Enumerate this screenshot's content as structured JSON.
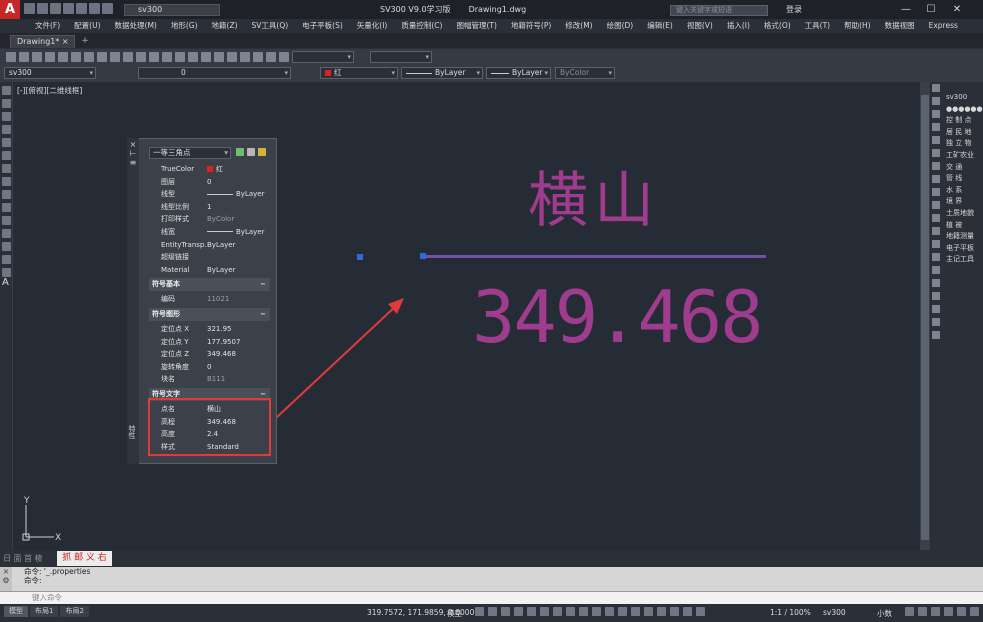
{
  "app": {
    "title": "SV300 V9.0学习版",
    "file": "Drawing1.dwg",
    "workspace": "sv300",
    "search_placeholder": "键入关键字或短语",
    "login": "登录"
  },
  "menu": [
    "文件(F)",
    "配置(U)",
    "数据处理(M)",
    "地形(G)",
    "地籍(Z)",
    "SV工具(Q)",
    "电子平板(S)",
    "矢量化(I)",
    "质量控制(C)",
    "图幅管理(T)",
    "地籍符号(P)",
    "修改(M)",
    "绘图(D)",
    "编辑(E)",
    "视图(V)",
    "插入(I)",
    "格式(O)",
    "工具(T)",
    "帮助(H)",
    "数据视图",
    "Express"
  ],
  "doc_tab": "Drawing1*",
  "toolbar": {
    "layer_combo": "sv300",
    "layer_state": "0",
    "color": "红",
    "linetype": "ByLayer",
    "lineweight": "ByLayer",
    "plotstyle": "ByColor"
  },
  "viewport_label": "[-][俯视][二维线框]",
  "drawing": {
    "name_text": "横山",
    "elev_text": "349.468",
    "text_color": "#a03c8e",
    "line_color": "#7050a8"
  },
  "properties": {
    "object_type": "一等三角点",
    "general": [
      {
        "k": "TrueColor",
        "v": "红",
        "swatch": true
      },
      {
        "k": "图层",
        "v": "0"
      },
      {
        "k": "线型",
        "v": "ByLayer",
        "line": true
      },
      {
        "k": "线型比例",
        "v": "1"
      },
      {
        "k": "打印样式",
        "v": "ByColor",
        "dim": true
      },
      {
        "k": "线宽",
        "v": "ByLayer",
        "line": true
      },
      {
        "k": "EntityTransp...",
        "v": "ByLayer"
      },
      {
        "k": "超级链接",
        "v": ""
      },
      {
        "k": "Material",
        "v": "ByLayer"
      }
    ],
    "sec_basic": "符号基本",
    "basic": [
      {
        "k": "编码",
        "v": "11021",
        "dim": true
      }
    ],
    "sec_shape": "符号图形",
    "shape": [
      {
        "k": "定位点 X",
        "v": "321.95"
      },
      {
        "k": "定位点 Y",
        "v": "177.9507"
      },
      {
        "k": "定位点 Z",
        "v": "349.468"
      },
      {
        "k": "旋转角度",
        "v": "0"
      },
      {
        "k": "块名",
        "v": "B111",
        "dim": true
      }
    ],
    "sec_text": "符号文字",
    "text": [
      {
        "k": "点名",
        "v": "横山"
      },
      {
        "k": "高程",
        "v": "349.468"
      },
      {
        "k": "高度",
        "v": "2.4"
      },
      {
        "k": "样式",
        "v": "Standard"
      }
    ],
    "side_label": "特性"
  },
  "right_palette": {
    "title": "sv300",
    "items": [
      "控 制 点",
      "居 民 地",
      "独 立 物",
      "工矿农业",
      "交    通",
      "管    线",
      "水    系",
      "境    界",
      "土质地貌",
      "植    被",
      "地籍测量",
      "电子平板",
      "主记工具"
    ]
  },
  "layout_tabs": {
    "left": "日 面 首 棱",
    "right": "抓 邮 义 右"
  },
  "command": {
    "line1": "命令: '_.properties",
    "line2": "命令:",
    "placeholder": "键入命令"
  },
  "status": {
    "tabs": [
      "模型",
      "布局1",
      "布局2"
    ],
    "coords": "319.7572, 171.9859, 0.0000",
    "model": "模型",
    "scale": "1:1 / 100%",
    "annotation": "sv300",
    "units": "小数"
  },
  "ucs": {
    "x": "X",
    "y": "Y"
  }
}
